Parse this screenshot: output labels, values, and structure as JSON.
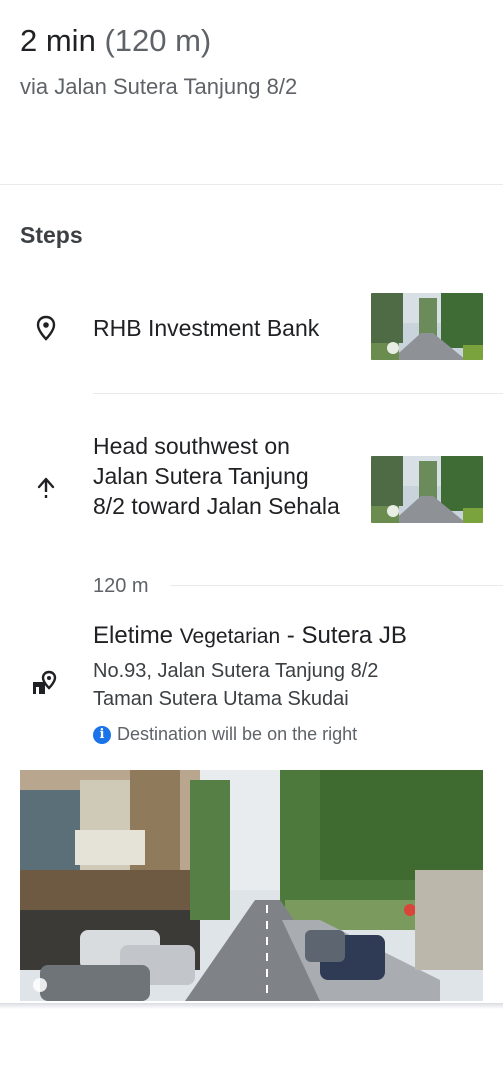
{
  "summary": {
    "duration": "2 min",
    "distance": "(120 m)",
    "via": "via Jalan Sutera Tanjung 8/2"
  },
  "steps_title": "Steps",
  "steps": [
    {
      "text": "RHB Investment Bank",
      "icon": "location-pin-icon"
    },
    {
      "text": "Head southwest on Jalan Sutera Tanjung 8/2 toward Jalan Sehala",
      "icon": "arrow-up-icon"
    }
  ],
  "step_distance": "120 m",
  "destination": {
    "name_part1": "Eletime",
    "name_part2": "Vegetarian",
    "name_part3": "- Sutera JB",
    "address_line1": "No.93, Jalan Sutera Tanjung 8/2",
    "address_line2": "Taman Sutera Utama Skudai",
    "note": "Destination will be on the right",
    "icon": "destination-flag-icon"
  },
  "colors": {
    "accent": "#1a73e8",
    "text_primary": "#202124",
    "text_secondary": "#5f6368"
  }
}
